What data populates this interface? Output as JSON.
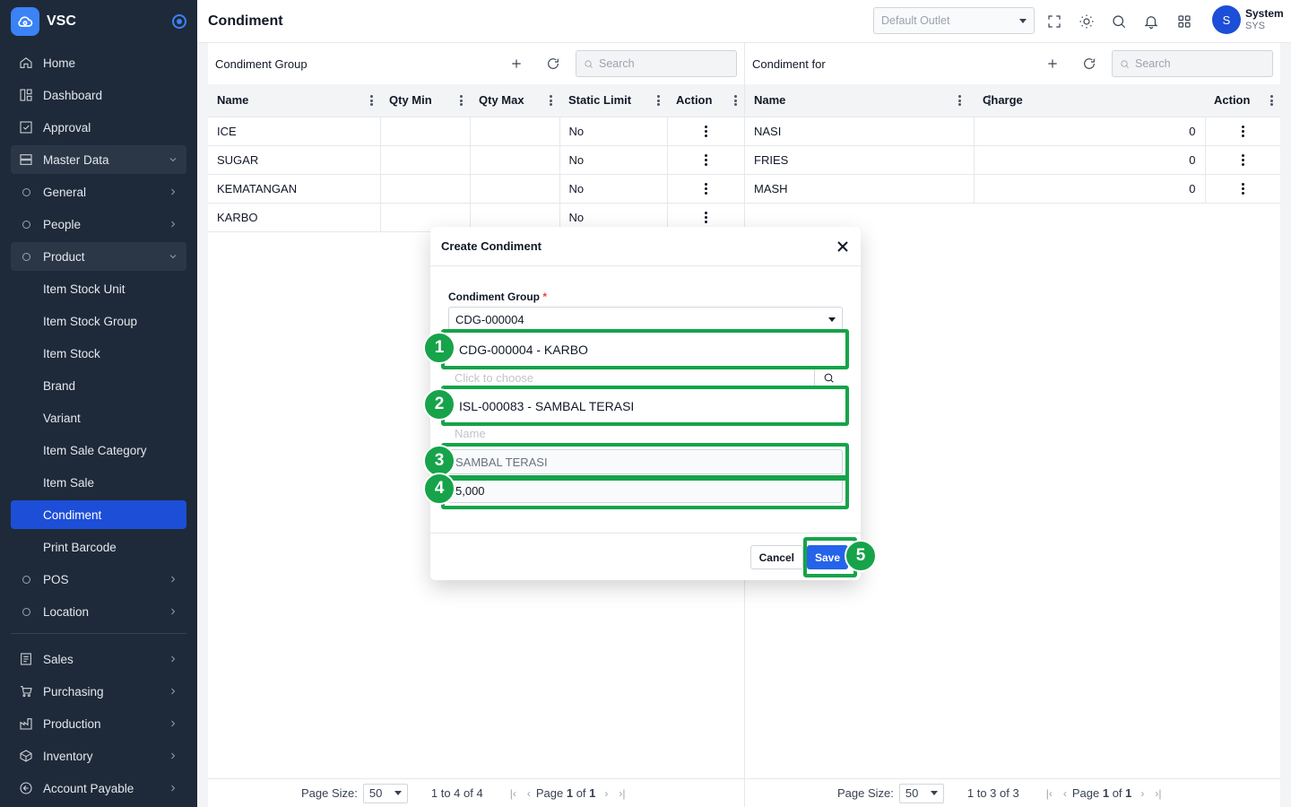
{
  "app": {
    "name": "VSC"
  },
  "sidebar": {
    "items": [
      {
        "label": "Home",
        "icon": "home-icon"
      },
      {
        "label": "Dashboard",
        "icon": "dashboard-icon"
      },
      {
        "label": "Approval",
        "icon": "approval-icon"
      },
      {
        "label": "Master Data",
        "icon": "database-icon"
      }
    ],
    "master_sub": [
      {
        "label": "General"
      },
      {
        "label": "People"
      },
      {
        "label": "Product"
      }
    ],
    "product_sub": [
      "Item Stock Unit",
      "Item Stock Group",
      "Item Stock",
      "Brand",
      "Variant",
      "Item Sale Category",
      "Item Sale",
      "Condiment",
      "Print Barcode"
    ],
    "after_product": [
      {
        "label": "POS"
      },
      {
        "label": "Location"
      }
    ],
    "bottom": [
      {
        "label": "Sales",
        "icon": "sales-icon"
      },
      {
        "label": "Purchasing",
        "icon": "cart-icon"
      },
      {
        "label": "Production",
        "icon": "production-icon"
      },
      {
        "label": "Inventory",
        "icon": "box-icon"
      },
      {
        "label": "Account Payable",
        "icon": "payable-icon"
      }
    ]
  },
  "header": {
    "title": "Condiment",
    "outlet_placeholder": "Default Outlet",
    "user": {
      "initial": "S",
      "name": "System",
      "code": "SYS"
    }
  },
  "left_panel": {
    "title": "Condiment Group",
    "search_placeholder": "Search",
    "columns": [
      "Name",
      "Qty Min",
      "Qty Max",
      "Static Limit",
      "Action"
    ],
    "rows": [
      {
        "name": "ICE",
        "qty_min": "",
        "qty_max": "",
        "static_limit": "No"
      },
      {
        "name": "SUGAR",
        "qty_min": "",
        "qty_max": "",
        "static_limit": "No"
      },
      {
        "name": "KEMATANGAN",
        "qty_min": "",
        "qty_max": "",
        "static_limit": "No"
      },
      {
        "name": "KARBO",
        "qty_min": "",
        "qty_max": "",
        "static_limit": "No"
      }
    ],
    "footer": {
      "page_size_label": "Page Size:",
      "page_size": "50",
      "range": "1 to 4 of 4",
      "page_word": "Page",
      "page": "1",
      "of_word": "of",
      "pages": "1"
    }
  },
  "right_panel": {
    "title": "Condiment for",
    "search_placeholder": "Search",
    "columns": [
      "Name",
      "",
      "Charge",
      "Action"
    ],
    "rows": [
      {
        "name": "NASI",
        "charge": "0"
      },
      {
        "name": "FRIES",
        "charge": "0"
      },
      {
        "name": "MASH",
        "charge": "0"
      }
    ],
    "footer": {
      "page_size_label": "Page Size:",
      "page_size": "50",
      "range": "1 to 3 of 3",
      "page_word": "Page",
      "page": "1",
      "of_word": "of",
      "pages": "1"
    }
  },
  "modal": {
    "title": "Create Condiment",
    "group_label": "Condiment Group",
    "required_mark": "*",
    "group_value": "CDG-000004",
    "group_option": "CDG-000004 - KARBO",
    "item_placeholder": "Click to choose",
    "item_value": "ISL-000083 - SAMBAL TERASI",
    "name_placeholder": "Name",
    "name_value": "SAMBAL TERASI",
    "charge_value": "5,000",
    "cancel_label": "Cancel",
    "save_label": "Save"
  },
  "annotations": [
    "1",
    "2",
    "3",
    "4",
    "5"
  ],
  "colors": {
    "sidebar_bg": "#1e2a3a",
    "accent": "#2563eb",
    "active_nav": "#1d4ed8",
    "callout": "#16a34a"
  }
}
